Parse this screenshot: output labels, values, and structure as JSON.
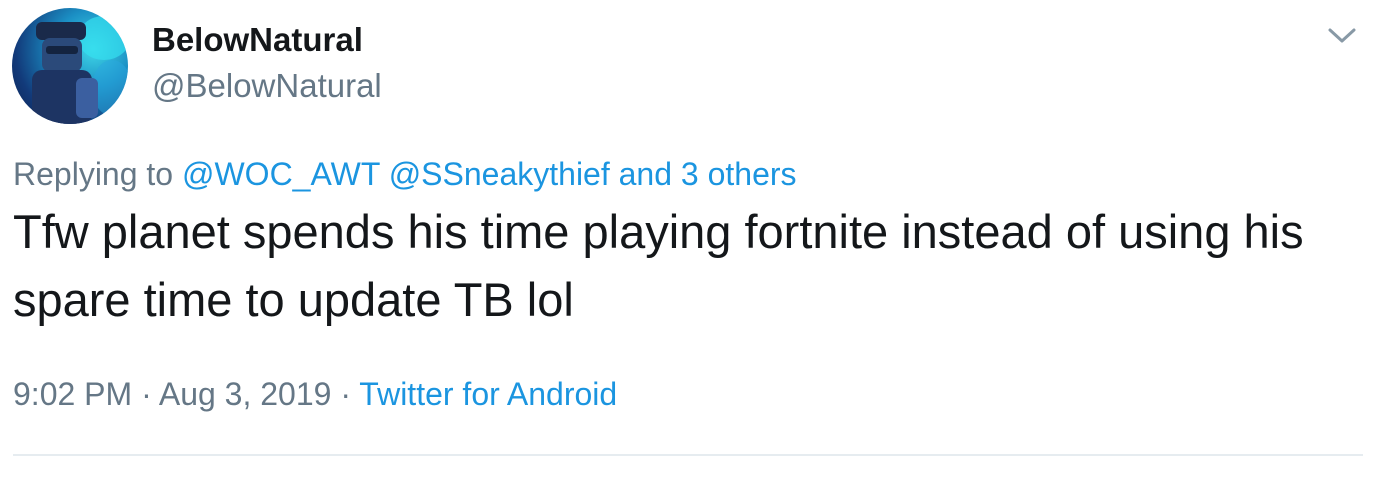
{
  "user": {
    "display_name": "BelowNatural",
    "handle": "@BelowNatural",
    "avatar_icon": "user-avatar"
  },
  "reply": {
    "prefix": "Replying to",
    "mentions": [
      "@WOC_AWT",
      "@SSneakythief"
    ],
    "others": "and 3 others"
  },
  "tweet": {
    "text": "Tfw planet spends his time playing fortnite instead of using his spare time to update TB lol"
  },
  "meta": {
    "time": "9:02 PM",
    "separator": "·",
    "date": "Aug 3, 2019",
    "source": "Twitter for Android"
  },
  "colors": {
    "link": "#1b95e0",
    "secondary_text": "#657786",
    "primary_text": "#14171a",
    "divider": "#e6ecf0"
  },
  "icons": {
    "menu": "chevron-down-icon"
  }
}
